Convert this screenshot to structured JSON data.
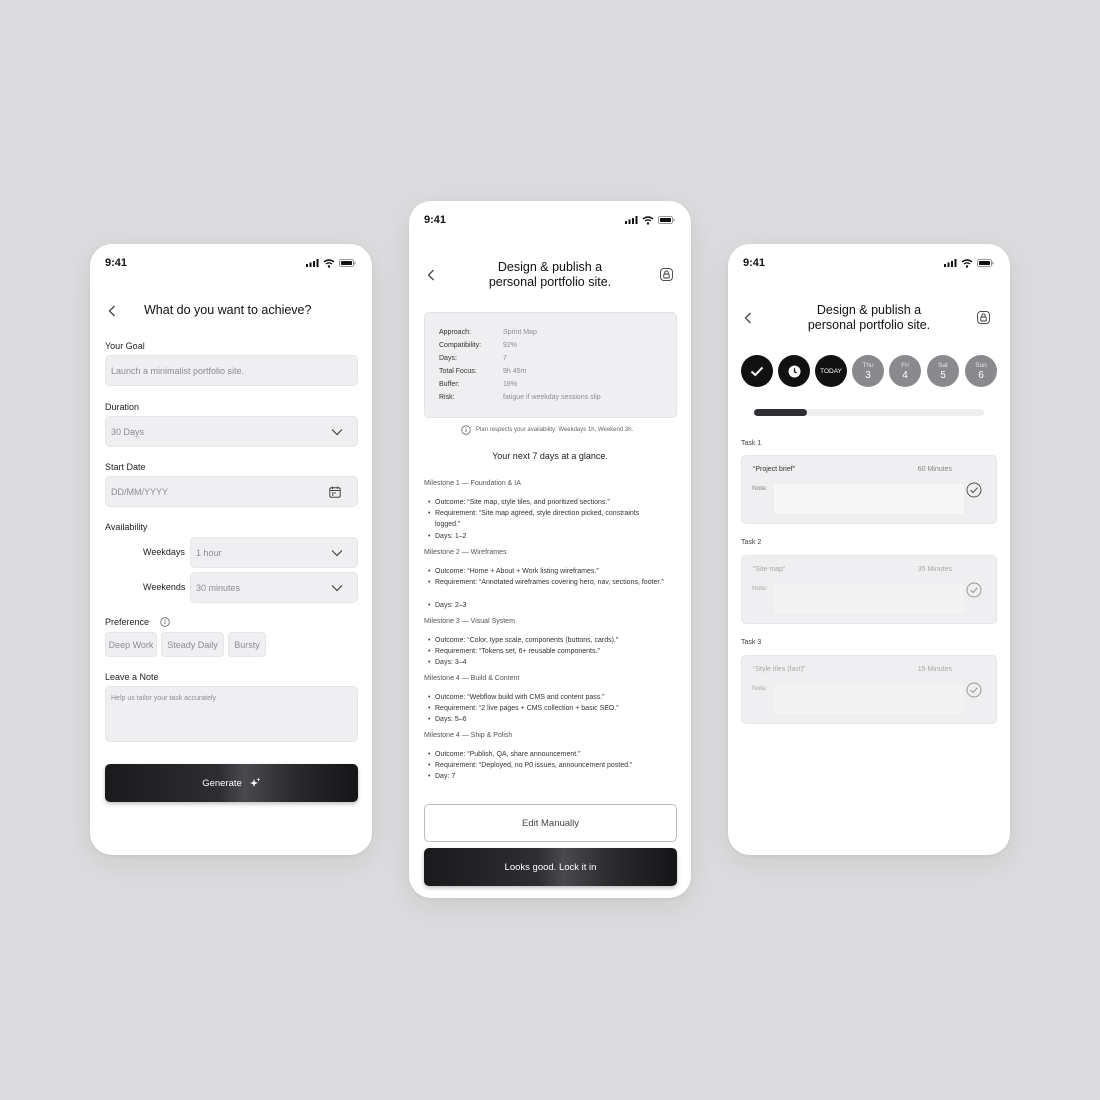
{
  "status": {
    "time": "9:41"
  },
  "screen1": {
    "title": "What do you want to achieve?",
    "goal": {
      "label": "Your Goal",
      "placeholder": "Launch a minimalist portfolio site."
    },
    "duration": {
      "label": "Duration",
      "value": "30 Days"
    },
    "start_date": {
      "label": "Start Date",
      "placeholder": "DD/MM/YYYY"
    },
    "availability": {
      "label": "Availability",
      "weekdays_label": "Weekdays",
      "weekdays_value": "1 hour",
      "weekends_label": "Weekends",
      "weekends_value": "30 minutes"
    },
    "preference": {
      "label": "Preference",
      "options": [
        "Deep Work",
        "Steady Daily",
        "Bursty"
      ]
    },
    "note": {
      "label": "Leave a Note",
      "placeholder": "Help us tailor your task accurately"
    },
    "generate_label": "Generate"
  },
  "screen2": {
    "title_line1": "Design & publish a",
    "title_line2": "personal portfolio site.",
    "summary": [
      {
        "key": "Approach:",
        "value": "Sprint Map"
      },
      {
        "key": "Compatibility:",
        "value": "92%"
      },
      {
        "key": "Days:",
        "value": "7"
      },
      {
        "key": "Total Focus:",
        "value": "9h 45m"
      },
      {
        "key": "Buffer:",
        "value": "18%"
      },
      {
        "key": "Risk:",
        "value": "fatigue if weekday sessions slip"
      }
    ],
    "plan_note": "Plan respects your availability: Weekdays 1h, Weekend 3h.",
    "glance": "Your next 7 days at a glance.",
    "milestones": [
      {
        "title": "Milestone 1 — Foundation & IA",
        "items": [
          "Outcome: “Site map, style tiles, and prioritized sections.”",
          "Requirement: “Site map agreed, style direction picked, constraints logged.”",
          "Days: 1–2"
        ]
      },
      {
        "title": "Milestone 2 — Wireframes",
        "items": [
          "Outcome: “Home + About + Work listing wireframes.”",
          "Requirement: “Annotated wireframes covering hero, nav, sections, footer.”",
          "Days: 2–3"
        ]
      },
      {
        "title": "Milestone 3 — Visual System",
        "items": [
          "Outcome: “Color, type scale, components (buttons, cards).”",
          "Requirement: “Tokens set, 6+ reusable components.”",
          "Days: 3–4"
        ]
      },
      {
        "title": "Milestone 4 — Build & Content",
        "items": [
          "Outcome: “Webflow build with CMS and content pass.”",
          "Requirement: “2 live pages + CMS collection + basic SEO.”",
          "Days: 5–6"
        ]
      },
      {
        "title": "Milestone 4 — Ship & Polish",
        "items": [
          "Outcome: “Publish, QA, share announcement.”",
          "Requirement: “Deployed, no P0 issues, announcement posted.”",
          "Day: 7"
        ]
      }
    ],
    "edit_label": "Edit Manually",
    "lock_label": "Looks good. Lock it in"
  },
  "screen3": {
    "title_line1": "Design & publish a",
    "title_line2": "personal portfolio site.",
    "today_label": "TODAY",
    "days": [
      {
        "name": "Thu",
        "num": "3"
      },
      {
        "name": "Fri",
        "num": "4"
      },
      {
        "name": "Sat",
        "num": "5"
      },
      {
        "name": "Sun",
        "num": "6"
      }
    ],
    "progress": 0.23,
    "tasks": [
      {
        "label": "Task 1",
        "name": "“Project brief”",
        "duration": "60 Minutes",
        "note_label": "Note:"
      },
      {
        "label": "Task 2",
        "name": "“Site map”",
        "duration": "35 Minutes",
        "note_label": "Note:"
      },
      {
        "label": "Task 3",
        "name": "“Style tiles (fast)”",
        "duration": "15 Minutes",
        "note_label": "Note:"
      }
    ]
  }
}
